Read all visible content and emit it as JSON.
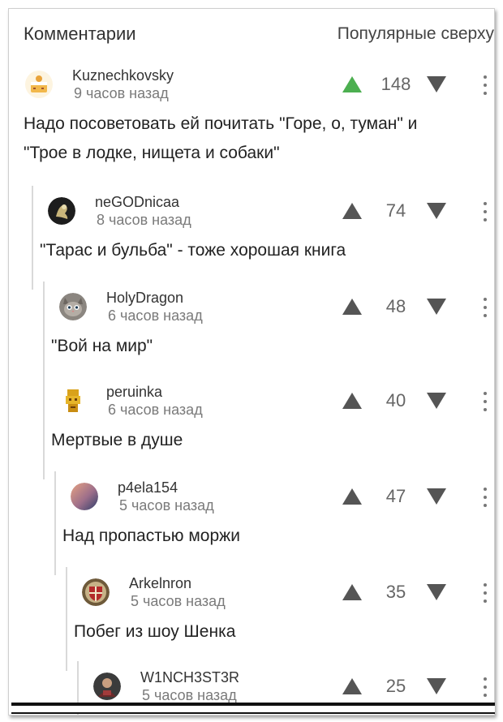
{
  "header": {
    "title": "Комментарии",
    "sort_label": "Популярные сверху"
  },
  "colors": {
    "upvote_active": "#4caf50",
    "vote_neutral": "#555555",
    "thread_line": "#d9d9d9"
  },
  "comments": [
    {
      "username": "Kuznechkovsky",
      "time": "9 часов назад",
      "score": "148",
      "upvoted": true,
      "avatar_icon": "cake-avatar-icon",
      "lines": [
        "Надо посоветовать ей почитать \"Горе, о, туман\" и",
        "\"Трое в лодке, нищета и собаки\""
      ]
    },
    {
      "username": "neGODnicaa",
      "time": "8 часов назад",
      "score": "74",
      "upvoted": false,
      "avatar_icon": "dark-figure-avatar-icon",
      "lines": [
        "\"Тарас и бульба\" - тоже хорошая книга"
      ]
    },
    {
      "username": "HolyDragon",
      "time": "6 часов назад",
      "score": "48",
      "upvoted": false,
      "avatar_icon": "cat-avatar-icon",
      "lines": [
        "\"Вой на мир\""
      ]
    },
    {
      "username": "peruinka",
      "time": "6 часов назад",
      "score": "40",
      "upvoted": false,
      "avatar_icon": "idol-avatar-icon",
      "lines": [
        "Мертвые в душе"
      ]
    },
    {
      "username": "p4ela154",
      "time": "5 часов назад",
      "score": "47",
      "upvoted": false,
      "avatar_icon": "gradient-avatar-icon",
      "lines": [
        "Над пропастью моржи"
      ]
    },
    {
      "username": "Arkelnron",
      "time": "5 часов назад",
      "score": "35",
      "upvoted": false,
      "avatar_icon": "shield-avatar-icon",
      "lines": [
        "Побег из шоу Шенка"
      ]
    },
    {
      "username": "W1NCH3ST3R",
      "time": "5 часов назад",
      "score": "25",
      "upvoted": false,
      "avatar_icon": "person-avatar-icon",
      "lines": []
    }
  ]
}
